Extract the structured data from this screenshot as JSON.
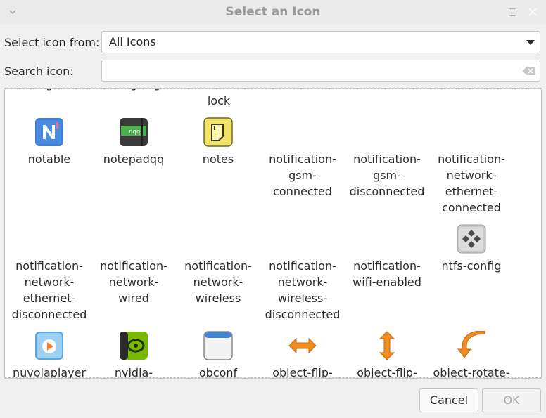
{
  "window": {
    "title": "Select an Icon"
  },
  "form": {
    "source_label": "Select icon from:",
    "source_value": "All Icons",
    "search_label": "Search icon:",
    "search_value": ""
  },
  "icons": {
    "row0_label": "lock",
    "row1": [
      "notable",
      "notepadqq",
      "notes",
      "notification-\ngsm-\nconnected",
      "notification-\ngsm-\ndisconnected",
      "notification-\nnetwork-\nethernet-\nconnected"
    ],
    "row2": [
      "notification-\nnetwork-\nethernet-\ndisconnected",
      "notification-\nnetwork-\nwired",
      "notification-\nnetwork-\nwireless",
      "notification-\nnetwork-\nwireless-\ndisconnected",
      "notification-\nwifi-enabled",
      "ntfs-config"
    ],
    "row3": [
      "nuvolaplayer",
      "nvidia-",
      "obconf",
      "object-flip-",
      "object-flip-",
      "object-rotate-"
    ],
    "notepadqq_glyph": "nqq"
  },
  "buttons": {
    "cancel": "Cancel",
    "ok": "OK"
  }
}
